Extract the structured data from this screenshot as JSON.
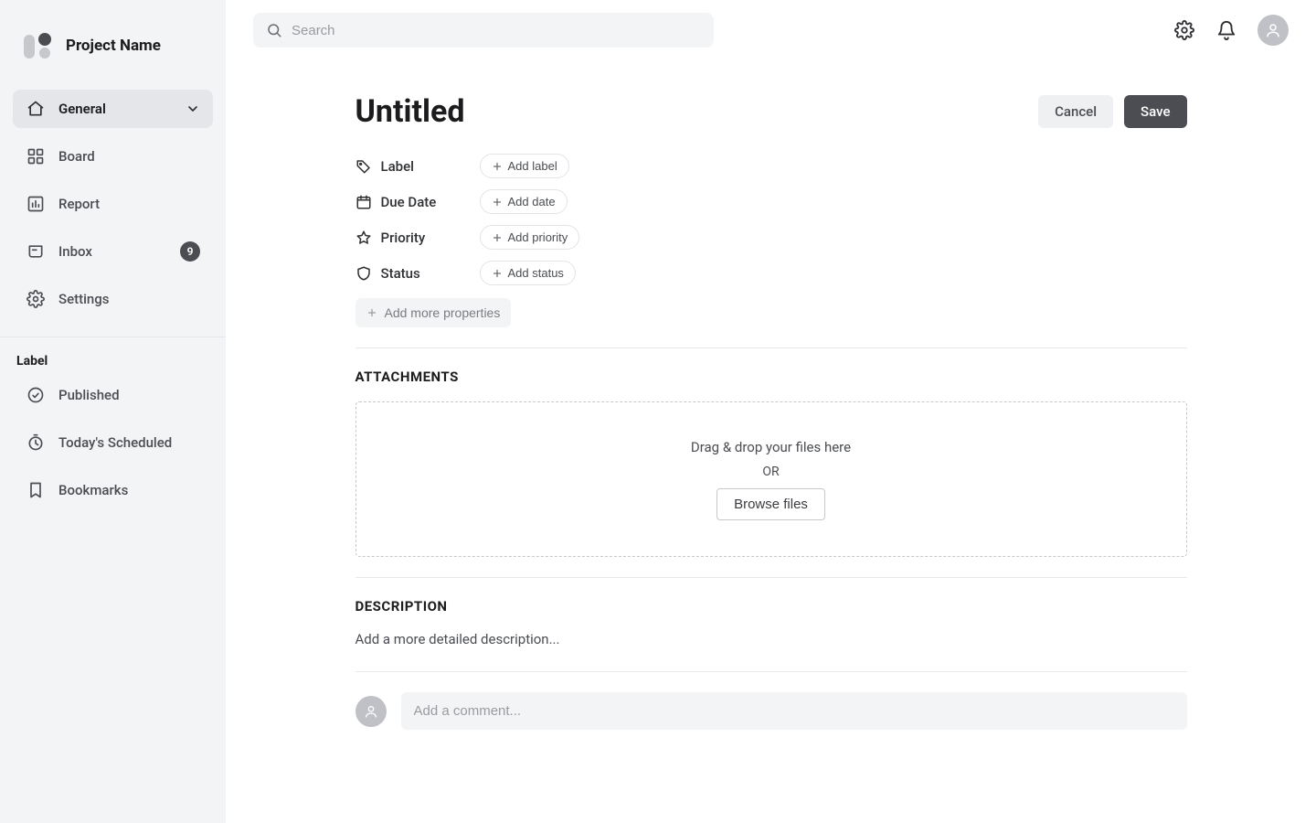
{
  "sidebar": {
    "title": "Project Name",
    "nav": [
      {
        "label": "General",
        "active": true,
        "expandable": true,
        "icon": "home"
      },
      {
        "label": "Board",
        "icon": "board"
      },
      {
        "label": "Report",
        "icon": "report"
      },
      {
        "label": "Inbox",
        "badge": "9",
        "icon": "inbox"
      },
      {
        "label": "Settings",
        "icon": "gear"
      }
    ],
    "section_label": "Label",
    "labels": [
      {
        "label": "Published",
        "icon": "check"
      },
      {
        "label": "Today's Scheduled",
        "icon": "clock"
      },
      {
        "label": "Bookmarks",
        "icon": "bookmark"
      }
    ]
  },
  "search": {
    "placeholder": "Search"
  },
  "page": {
    "title": "Untitled",
    "cancel": "Cancel",
    "save": "Save",
    "properties": [
      {
        "name": "Label",
        "button": "Add label",
        "icon": "tag"
      },
      {
        "name": "Due Date",
        "button": "Add date",
        "icon": "calendar"
      },
      {
        "name": "Priority",
        "button": "Add priority",
        "icon": "star"
      },
      {
        "name": "Status",
        "button": "Add status",
        "icon": "shield"
      }
    ],
    "add_more": "Add more properties",
    "attachments_heading": "ATTACHMENTS",
    "drop_text": "Drag & drop your files here",
    "or_text": "OR",
    "browse_text": "Browse files",
    "description_heading": "DESCRIPTION",
    "description_placeholder": "Add a more detailed description...",
    "comment_placeholder": "Add a comment..."
  }
}
